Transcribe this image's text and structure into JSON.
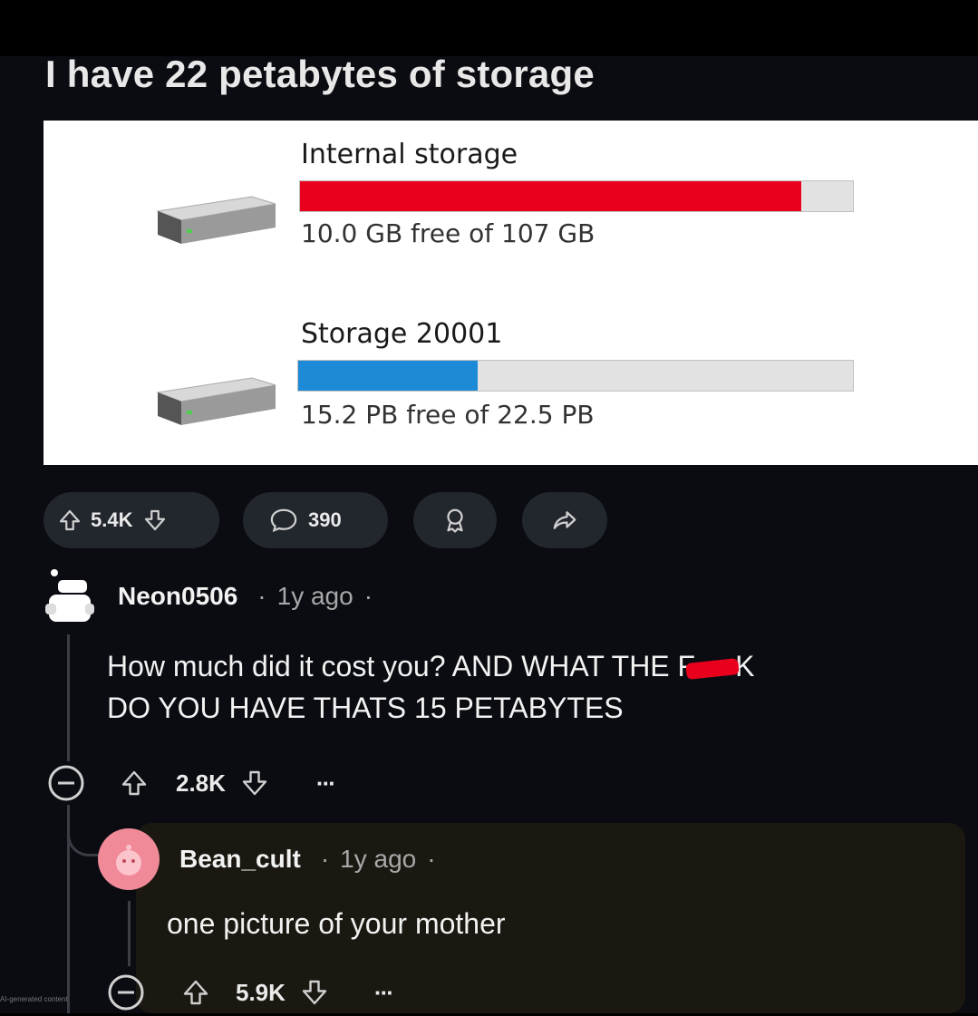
{
  "post": {
    "title": "I have 22 petabytes of storage",
    "drives": [
      {
        "name": "Internal storage",
        "usage_text": "10.0 GB free of 107 GB",
        "used_fraction": 0.907,
        "bar_color": "#e8001c"
      },
      {
        "name": "Storage 20001",
        "usage_text": "15.2 PB free of 22.5 PB",
        "used_fraction": 0.324,
        "bar_color": "#1c8ad6"
      }
    ],
    "actions": {
      "upvote_count": "5.4K",
      "comment_count": "390"
    }
  },
  "comments": [
    {
      "username": "Neon0506",
      "sep1": "·",
      "time": "1y ago",
      "sep2": "·",
      "text_line1": "How much did it cost you? AND WHAT THE F",
      "text_redacted_end": "K",
      "text_line2": "DO YOU HAVE THATS 15 PETABYTES",
      "votes": "2.8K",
      "more": "···",
      "redaction_color": "#e8001c"
    },
    {
      "username": "Bean_cult",
      "sep1": "·",
      "time": "1y ago",
      "sep2": "·",
      "text": "one picture of your mother",
      "votes": "5.9K",
      "more": "···",
      "avatar_color": "#f08a99"
    }
  ],
  "watermark": "AI-generated content"
}
